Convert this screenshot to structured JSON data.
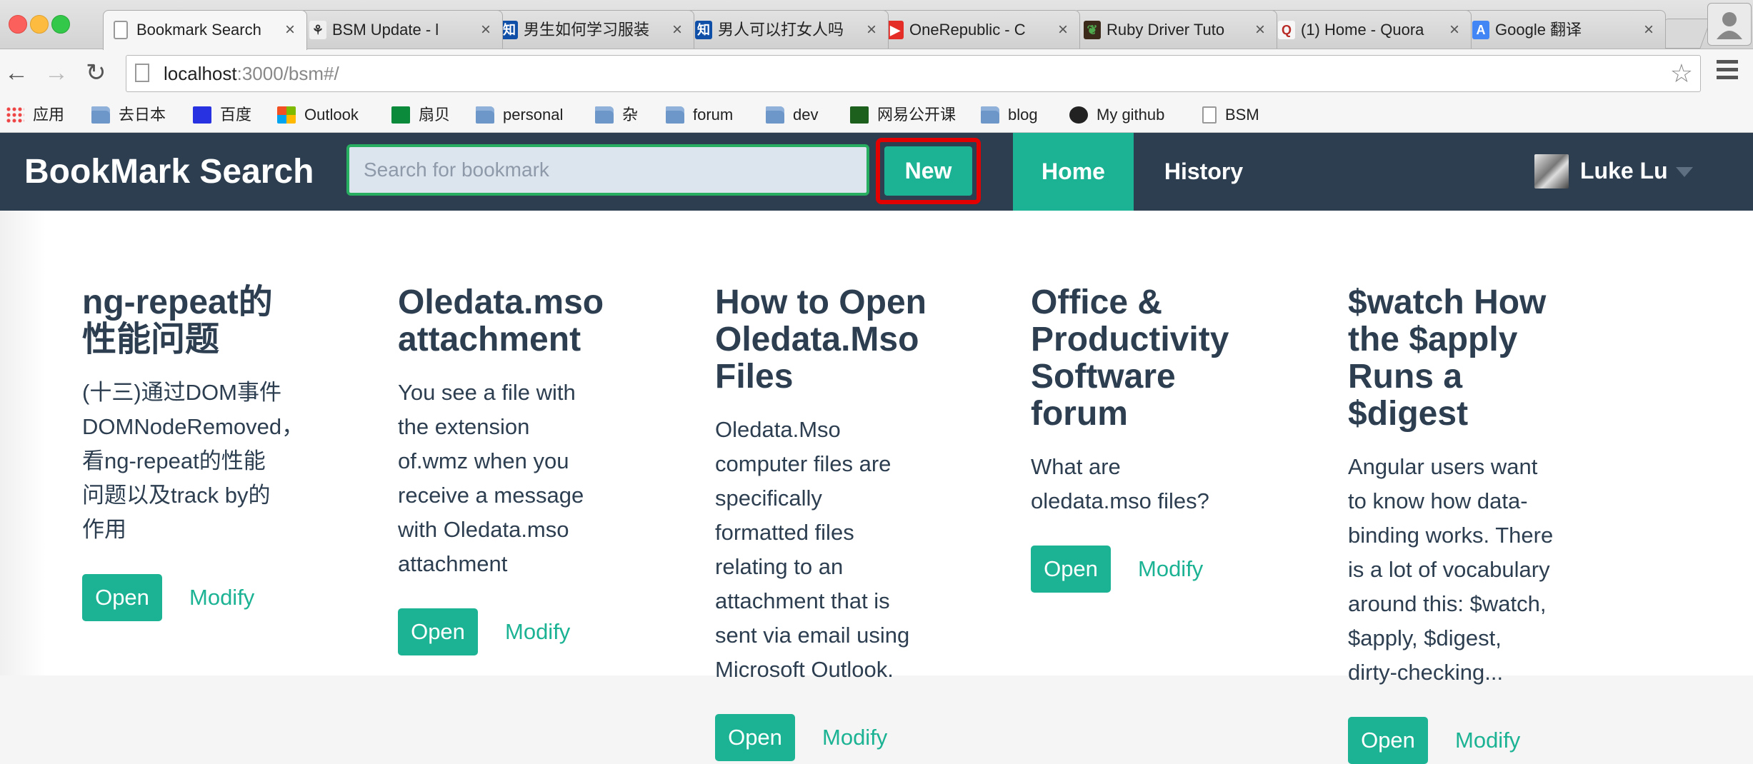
{
  "browser": {
    "tabs": [
      {
        "title": "Bookmark Search",
        "favicon": "page-icon",
        "fav_text": "",
        "fav_color": "#ffffff",
        "fav_fg": "#999999"
      },
      {
        "title": "BSM Update - l",
        "favicon": "bsm-icon",
        "fav_text": "⚘",
        "fav_color": "#f0f0f0",
        "fav_fg": "#333333"
      },
      {
        "title": "男生如何学习服装",
        "favicon": "zhihu-icon",
        "fav_text": "知",
        "fav_color": "#0f4fa8",
        "fav_fg": "#ffffff"
      },
      {
        "title": "男人可以打女人吗",
        "favicon": "zhihu-icon",
        "fav_text": "知",
        "fav_color": "#0f4fa8",
        "fav_fg": "#ffffff"
      },
      {
        "title": "OneRepublic - C",
        "favicon": "youtube-icon",
        "fav_text": "▶",
        "fav_color": "#e52d27",
        "fav_fg": "#ffffff"
      },
      {
        "title": "Ruby Driver Tuto",
        "favicon": "mongodb-leaf-icon",
        "fav_text": "❦",
        "fav_color": "#3b2a1a",
        "fav_fg": "#4fa94d"
      },
      {
        "title": "(1) Home - Quora",
        "favicon": "quora-icon",
        "fav_text": "Q",
        "fav_color": "#f6f6f6",
        "fav_fg": "#b92b27"
      },
      {
        "title": "Google 翻译",
        "favicon": "google-translate-icon",
        "fav_text": "A",
        "fav_color": "#4285f4",
        "fav_fg": "#ffffff"
      }
    ],
    "url_host": "localhost",
    "url_rest": ":3000/bsm#/",
    "bookmarks": [
      {
        "label": "应用",
        "icon": "apps-grid-icon",
        "color": "#e44"
      },
      {
        "label": "去日本",
        "icon": "folder-icon",
        "color": "#6e97c9"
      },
      {
        "label": "百度",
        "icon": "baidu-paw-icon",
        "color": "#2932e1"
      },
      {
        "label": "Outlook",
        "icon": "windows-logo-icon",
        "color": "#f25022"
      },
      {
        "label": "扇贝",
        "icon": "shanbay-icon",
        "color": "#0c8a3c"
      },
      {
        "label": "personal",
        "icon": "folder-icon",
        "color": "#6e97c9"
      },
      {
        "label": "杂",
        "icon": "folder-icon",
        "color": "#6e97c9"
      },
      {
        "label": "forum",
        "icon": "folder-icon",
        "color": "#6e97c9"
      },
      {
        "label": "dev",
        "icon": "folder-icon",
        "color": "#6e97c9"
      },
      {
        "label": "网易公开课",
        "icon": "netease-play-icon",
        "color": "#1d5f1d"
      },
      {
        "label": "blog",
        "icon": "folder-icon",
        "color": "#6e97c9"
      },
      {
        "label": "My github",
        "icon": "github-icon",
        "color": "#222222"
      },
      {
        "label": "BSM",
        "icon": "page-icon",
        "color": "#ffffff"
      }
    ]
  },
  "app": {
    "brand": "BookMark Search",
    "search_placeholder": "Search for bookmark",
    "new_label": "New",
    "nav": {
      "home": "Home",
      "history": "History"
    },
    "user": {
      "name": "Luke Lu"
    },
    "colors": {
      "navbar": "#2c3e50",
      "accent": "#1cb394",
      "highlight": "#e30000"
    }
  },
  "cards": [
    {
      "title": "ng-repeat的\n性能问题",
      "desc": "(十三)通过DOM事件\nDOMNodeRemoved，\n看ng-repeat的性能\n问题以及track by的\n作用",
      "open": "Open",
      "modify": "Modify"
    },
    {
      "title": "Oledata.mso\nattachment",
      "desc": "You see a file with\nthe extension\nof.wmz when you\nreceive a message\nwith Oledata.mso\nattachment",
      "open": "Open",
      "modify": "Modify"
    },
    {
      "title": "How to Open\nOledata.Mso\nFiles",
      "desc": "Oledata.Mso\ncomputer files are\nspecifically\nformatted files\nrelating to an\nattachment that is\nsent via email using\nMicrosoft Outlook.",
      "open": "Open",
      "modify": "Modify"
    },
    {
      "title": "Office &\nProductivity\nSoftware\nforum",
      "desc": "What are\noledata.mso files?",
      "open": "Open",
      "modify": "Modify"
    },
    {
      "title": "$watch How\nthe $apply\nRuns a\n$digest",
      "desc": "Angular users want\nto know how data-\nbinding works. There\nis a lot of vocabulary\naround this: $watch,\n$apply, $digest,\ndirty-checking...",
      "open": "Open",
      "modify": "Modify"
    }
  ]
}
